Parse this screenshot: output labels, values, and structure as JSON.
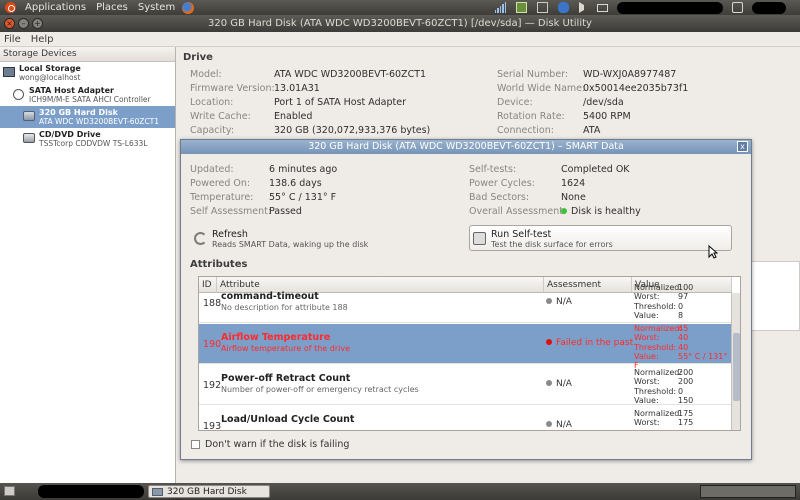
{
  "top_panel": {
    "menus": [
      "Applications",
      "Places",
      "System"
    ]
  },
  "window": {
    "title": "320 GB Hard Disk (ATA WDC WD3200BEVT-60ZCT1) [/dev/sda] — Disk Utility",
    "menu": [
      "File",
      "Help"
    ]
  },
  "sidebar": {
    "header": "Storage Devices",
    "items": [
      {
        "title": "Local Storage",
        "subtitle": "wong@localhost",
        "icon": "computer-icon"
      },
      {
        "title": "SATA Host Adapter",
        "subtitle": "ICH9M/M-E SATA AHCI Controller",
        "icon": "controller-icon"
      },
      {
        "title": "320 GB Hard Disk",
        "subtitle": "ATA WDC WD3200BEVT-60ZCT1",
        "icon": "hard-disk-icon",
        "selected": true
      },
      {
        "title": "CD/DVD Drive",
        "subtitle": "TSSTcorp CDDVDW TS-L633L",
        "icon": "optical-drive-icon"
      }
    ]
  },
  "drive": {
    "section_title": "Drive",
    "left": [
      {
        "k": "Model:",
        "v": "ATA WDC WD3200BEVT-60ZCT1"
      },
      {
        "k": "Firmware Version:",
        "v": "13.01A31"
      },
      {
        "k": "Location:",
        "v": "Port 1 of SATA Host Adapter"
      },
      {
        "k": "Write Cache:",
        "v": "Enabled"
      },
      {
        "k": "Capacity:",
        "v": "320 GB (320,072,933,376 bytes)"
      }
    ],
    "right": [
      {
        "k": "Serial Number:",
        "v": "WD-WXJ0A8977487"
      },
      {
        "k": "World Wide Name:",
        "v": "0x50014ee2035b73f1"
      },
      {
        "k": "Device:",
        "v": "/dev/sda"
      },
      {
        "k": "Rotation Rate:",
        "v": "5400 RPM"
      },
      {
        "k": "Connection:",
        "v": "ATA"
      }
    ]
  },
  "smart": {
    "title": "320 GB Hard Disk (ATA WDC WD3200BEVT-60ZCT1) – SMART Data",
    "close_label": "x",
    "left": [
      {
        "k": "Updated:",
        "v": "6 minutes ago"
      },
      {
        "k": "Powered On:",
        "v": "138.6 days"
      },
      {
        "k": "Temperature:",
        "v": "55° C / 131° F"
      },
      {
        "k": "Self Assessment:",
        "v": "Passed"
      }
    ],
    "right": [
      {
        "k": "Self-tests:",
        "v": "Completed OK"
      },
      {
        "k": "Power Cycles:",
        "v": "1624"
      },
      {
        "k": "Bad Sectors:",
        "v": "None"
      },
      {
        "k": "Overall Assessment:",
        "v": "Disk is healthy"
      }
    ],
    "healthy_color": "#3ec23e",
    "refresh": {
      "label": "Refresh",
      "sub": "Reads SMART Data, waking up the disk"
    },
    "selftest": {
      "label": "Run Self-test",
      "sub": "Test the disk surface for errors"
    },
    "attributes_heading": "Attributes",
    "columns": [
      "ID",
      "Attribute",
      "Assessment",
      "Value"
    ],
    "rows": [
      {
        "id": "188",
        "name": "command-timeout",
        "desc": "No description for attribute 188",
        "assessment": "N/A",
        "normalized": "100",
        "worst": "97",
        "threshold": "0",
        "value": "8",
        "status_color": "#8a8a8a"
      },
      {
        "id": "190",
        "name": "Airflow Temperature",
        "desc": "Airflow temperature of the drive",
        "assessment": "Failed in the past",
        "normalized": "45",
        "worst": "40",
        "threshold": "40",
        "value": "55° C / 131° F",
        "status_color": "#e01010",
        "selected": true
      },
      {
        "id": "192",
        "name": "Power-off Retract Count",
        "desc": "Number of power-off or emergency retract cycles",
        "assessment": "N/A",
        "normalized": "200",
        "worst": "200",
        "threshold": "0",
        "value": "150",
        "status_color": "#8a8a8a"
      },
      {
        "id": "193",
        "name": "Load/Unload Cycle Count",
        "desc": "",
        "assessment": "N/A",
        "normalized": "175",
        "worst": "175",
        "threshold": "",
        "value": "",
        "status_color": "#8a8a8a"
      }
    ],
    "value_labels": [
      "Normalized:",
      "Worst:",
      "Threshold:",
      "Value:"
    ],
    "checkbox_label": "Don't warn if the disk is failing"
  },
  "taskbar": {
    "task_label": "320 GB Hard Disk (AT..."
  }
}
